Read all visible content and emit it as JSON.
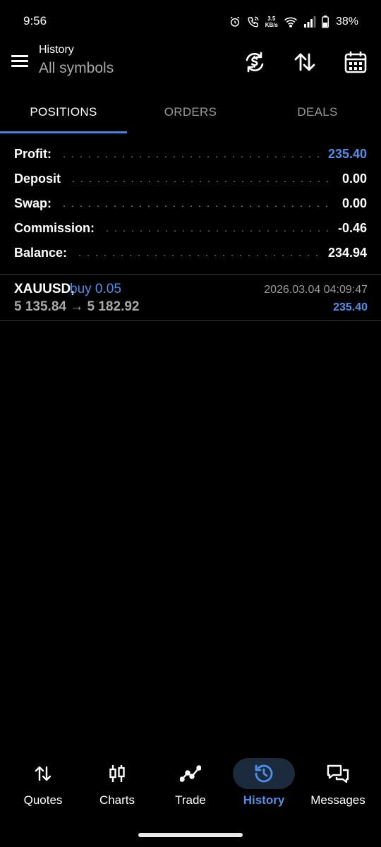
{
  "status_bar": {
    "time": "9:56",
    "net_speed_value": "3.5",
    "net_speed_unit": "KB/s",
    "battery": "38%"
  },
  "header": {
    "title": "History",
    "subtitle": "All symbols",
    "icons": [
      "menu-icon",
      "sync-currency-icon",
      "sort-icon",
      "calendar-icon"
    ]
  },
  "tabs": [
    {
      "label": "POSITIONS",
      "active": true
    },
    {
      "label": "ORDERS",
      "active": false
    },
    {
      "label": "DEALS",
      "active": false
    }
  ],
  "summary": [
    {
      "label": "Profit:",
      "value": "235.40"
    },
    {
      "label": "Deposit",
      "value": "0.00"
    },
    {
      "label": "Swap:",
      "value": "0.00"
    },
    {
      "label": "Commission:",
      "value": "-0.46"
    },
    {
      "label": "Balance:",
      "value": "234.94"
    }
  ],
  "positions": [
    {
      "symbol": "XAUUSD,",
      "side": "buy 0.05",
      "prices": "5 135.84 → 5 182.92",
      "time": "2026.03.04 04:09:47",
      "profit": "235.40"
    }
  ],
  "bottom_nav": [
    {
      "label": "Quotes",
      "icon": "quotes-icon",
      "active": false
    },
    {
      "label": "Charts",
      "icon": "charts-icon",
      "active": false
    },
    {
      "label": "Trade",
      "icon": "trade-icon",
      "active": false
    },
    {
      "label": "History",
      "icon": "history-icon",
      "active": true
    },
    {
      "label": "Messages",
      "icon": "messages-icon",
      "active": false
    }
  ],
  "colors": {
    "accent": "#4f8fe8",
    "background": "#000000",
    "divider": "#3a3a3a"
  }
}
